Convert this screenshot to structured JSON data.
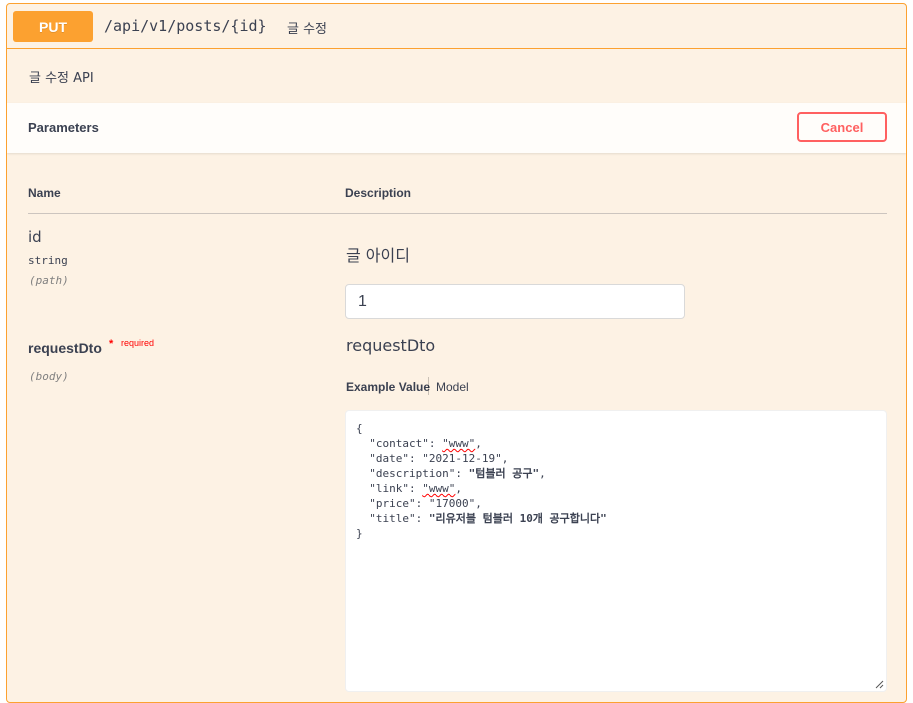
{
  "operation": {
    "method": "PUT",
    "path": "/api/v1/posts/{id}",
    "summary": "글 수정",
    "description": "글 수정 API"
  },
  "parameters_section": {
    "title": "Parameters",
    "cancel_label": "Cancel",
    "headers": {
      "name": "Name",
      "description": "Description"
    }
  },
  "parameters": [
    {
      "name": "id",
      "type": "string",
      "in": "(path)",
      "description": "글 아이디",
      "value": "1"
    },
    {
      "name": "requestDto",
      "required_star": "*",
      "required_text": "required",
      "in": "(body)",
      "description": "requestDto"
    }
  ],
  "body_tabs": {
    "example": "Example Value",
    "model": "Model"
  },
  "body": {
    "open": "{",
    "lines": [
      {
        "key": "\"contact\"",
        "value": "\"www\"",
        "spell": true
      },
      {
        "key": "\"date\"",
        "value": "\"2021-12-19\""
      },
      {
        "key": "\"description\"",
        "value": "\"텀블러 공구\""
      },
      {
        "key": "\"link\"",
        "value": "\"www\"",
        "spell": true
      },
      {
        "key": "\"price\"",
        "value": "\"17000\""
      },
      {
        "key": "\"title\"",
        "value": "\"리유저블 텀블러 10개 공구합니다\""
      }
    ],
    "close": "}"
  },
  "colors": {
    "put": "#fca130",
    "cancel": "#ff6060",
    "required": "#ff0000"
  },
  "icons": [
    "resize-handle-icon"
  ]
}
